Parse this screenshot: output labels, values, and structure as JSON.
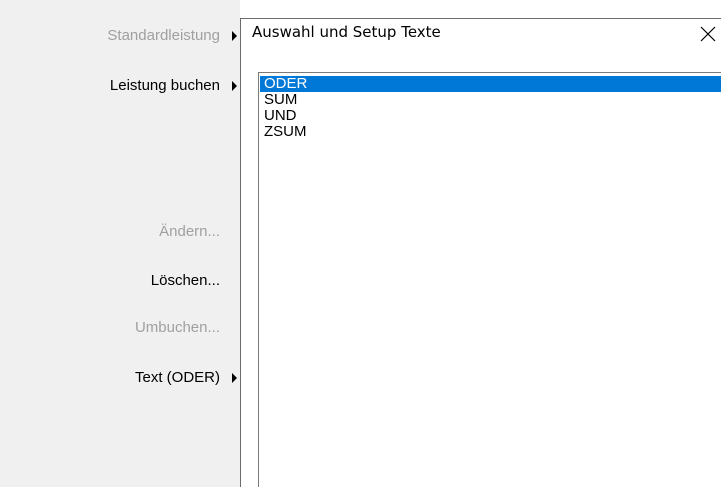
{
  "context_menu": {
    "items": [
      {
        "label": "Standardleistung",
        "enabled": false,
        "submenu": true
      },
      {
        "label": "Leistung buchen",
        "enabled": true,
        "submenu": true
      },
      {
        "label": "Ändern...",
        "enabled": false,
        "submenu": false
      },
      {
        "label": "Löschen...",
        "enabled": true,
        "submenu": false
      },
      {
        "label": "Umbuchen...",
        "enabled": false,
        "submenu": false
      },
      {
        "label": "Text (ODER)",
        "enabled": true,
        "submenu": true
      }
    ]
  },
  "dialog": {
    "title": "Auswahl und Setup Texte",
    "close_icon": "close-icon",
    "list": {
      "items": [
        "ODER",
        "SUM",
        "UND",
        "ZSUM"
      ],
      "selected": "ODER"
    }
  },
  "colors": {
    "selection": "#0078d7",
    "menu_background": "#f0f0f0",
    "disabled_text": "#a0a0a0"
  }
}
